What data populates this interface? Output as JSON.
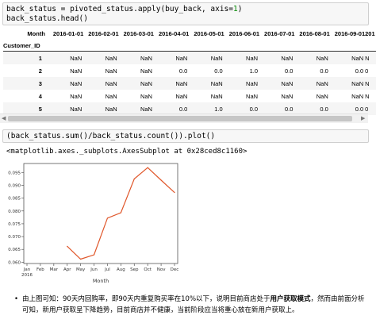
{
  "cell1": {
    "line1_a": "back_status = pivoted_status.apply(buy_back, ",
    "line1_kw": "axis",
    "line1_eq": "=",
    "line1_num": "1",
    "line1_end": ")",
    "line2": "back_status.head()"
  },
  "table": {
    "columns_label": "Month",
    "index_label": "Customer_ID",
    "columns": [
      "2016-01-01",
      "2016-02-01",
      "2016-03-01",
      "2016-04-01",
      "2016-05-01",
      "2016-06-01",
      "2016-07-01",
      "2016-08-01",
      "2016-09-01",
      "201"
    ],
    "rows": [
      {
        "id": "1",
        "values": [
          "NaN",
          "NaN",
          "NaN",
          "NaN",
          "NaN",
          "NaN",
          "NaN",
          "NaN",
          "NaN",
          "N"
        ]
      },
      {
        "id": "2",
        "values": [
          "NaN",
          "NaN",
          "NaN",
          "0.0",
          "0.0",
          "1.0",
          "0.0",
          "0.0",
          "0.0",
          "0"
        ]
      },
      {
        "id": "3",
        "values": [
          "NaN",
          "NaN",
          "NaN",
          "NaN",
          "NaN",
          "NaN",
          "NaN",
          "NaN",
          "NaN",
          "N"
        ]
      },
      {
        "id": "4",
        "values": [
          "NaN",
          "NaN",
          "NaN",
          "NaN",
          "NaN",
          "NaN",
          "NaN",
          "NaN",
          "NaN",
          "N"
        ]
      },
      {
        "id": "5",
        "values": [
          "NaN",
          "NaN",
          "NaN",
          "0.0",
          "1.0",
          "0.0",
          "0.0",
          "0.0",
          "0.0",
          "0"
        ]
      }
    ]
  },
  "cell2": {
    "code_a": "(back_status.sum()/back_status.count()).plot()"
  },
  "output2": "<matplotlib.axes._subplots.AxesSubplot at 0x28ced8c1160>",
  "chart_data": {
    "type": "line",
    "xlabel": "Month",
    "x_ticks": [
      "Jan\n2016",
      "Feb",
      "Mar",
      "Apr",
      "May",
      "Jun",
      "Jul",
      "Aug",
      "Sep",
      "Oct",
      "Nov",
      "Dec"
    ],
    "y_ticks": [
      "0.060",
      "0.065",
      "0.070",
      "0.075",
      "0.080",
      "0.085",
      "0.090",
      "0.095"
    ],
    "ylim": [
      0.0595,
      0.0985
    ],
    "series": [
      {
        "color": "#e0572b",
        "x": [
          "Apr",
          "May",
          "Jun",
          "Jul",
          "Aug",
          "Sep",
          "Oct",
          "Nov",
          "Dec"
        ],
        "values": [
          0.0662,
          0.0612,
          0.0629,
          0.0772,
          0.0793,
          0.0925,
          0.0969,
          0.092,
          0.0872
        ]
      }
    ],
    "grid": false
  },
  "note": {
    "part1": "由上图可知：90天内回购率，即90天内重复购买率在10%以下，说明目前商店处于",
    "bold": "用户获取模式",
    "part2": "，然而由前面分析可知，新用户获取呈下降趋势，目前商店并不健康，当前阶段应当将重心放在新用户获取上。"
  }
}
